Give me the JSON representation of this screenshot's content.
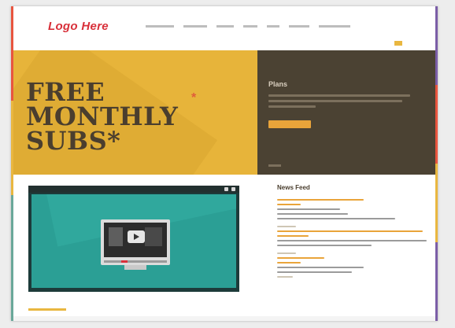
{
  "header": {
    "logo": "Logo Here",
    "nav": [
      "",
      "",
      "",
      "",
      "",
      "",
      ""
    ]
  },
  "hero": {
    "line1": "FREE",
    "line2": "MONTHLY",
    "line3": "SUBS*",
    "star": "*"
  },
  "promo": {
    "title": "Plans"
  },
  "news": {
    "title": "News Feed"
  },
  "colors": {
    "brand_red": "#d8303a",
    "hero_yellow": "#e7b43a",
    "promo_brown": "#4b4233",
    "video_teal": "#2b9f95",
    "accent_orange": "#e9a43a"
  }
}
